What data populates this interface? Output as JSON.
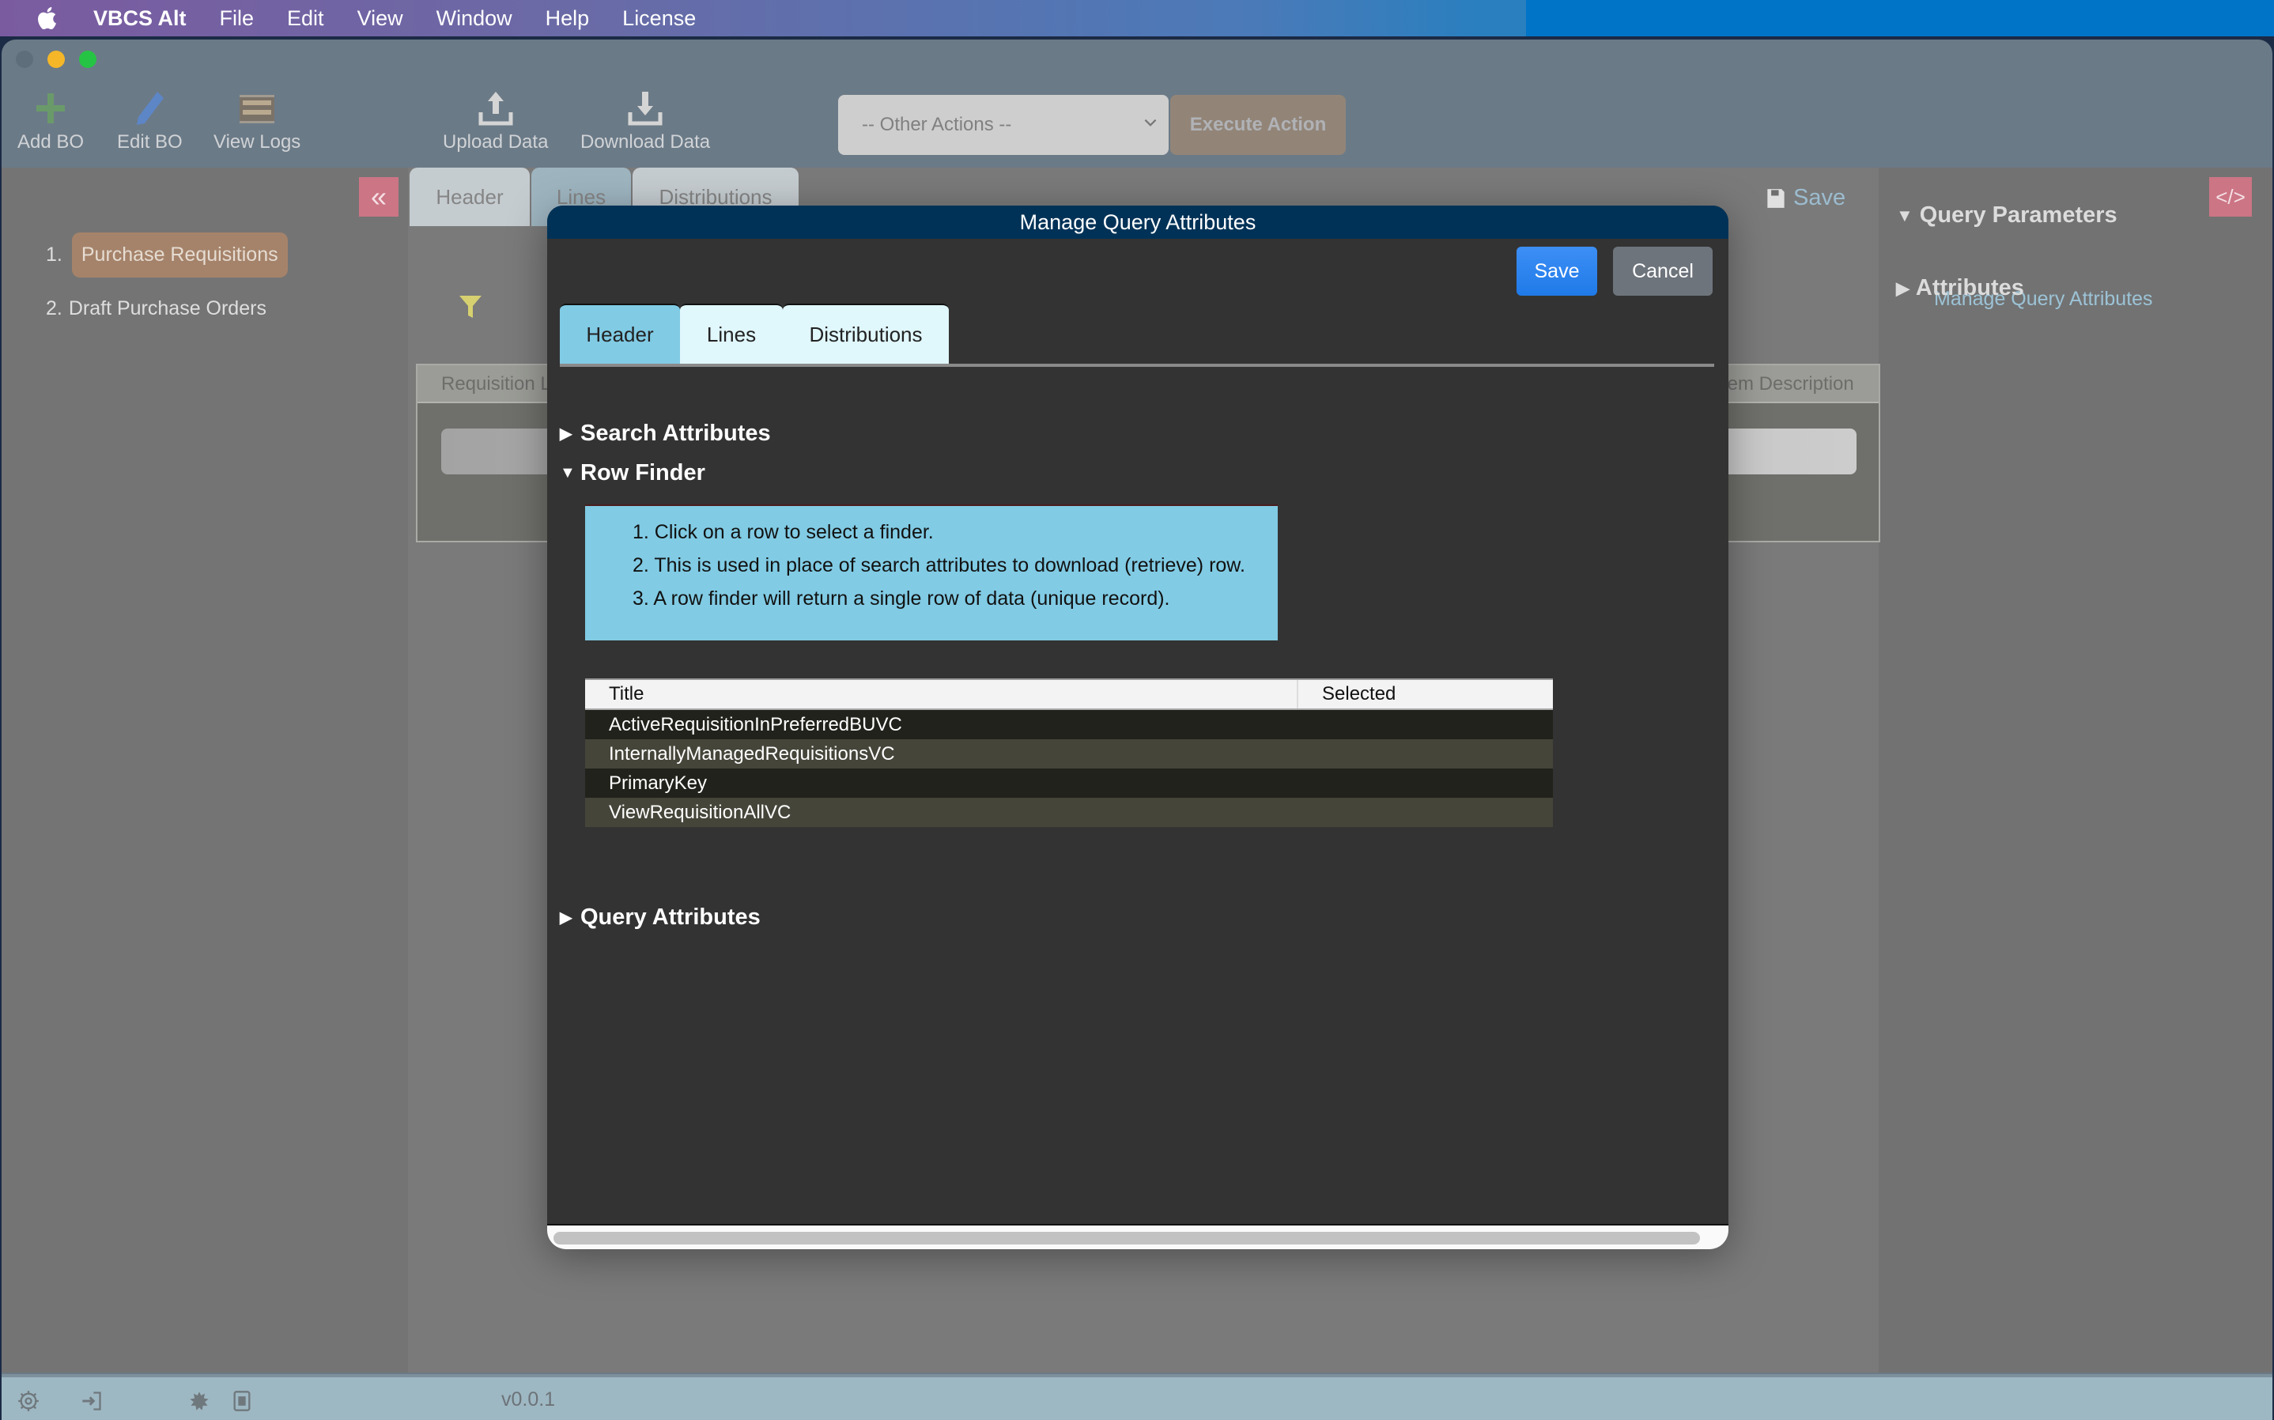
{
  "menubar": {
    "app_name": "VBCS Alt",
    "items": [
      "File",
      "Edit",
      "View",
      "Window",
      "Help",
      "License"
    ]
  },
  "toolbar": {
    "add_bo": "Add BO",
    "edit_bo": "Edit BO",
    "view_logs": "View Logs",
    "upload_data": "Upload Data",
    "download_data": "Download Data",
    "other_actions_selected": "-- Other Actions --",
    "execute_action": "Execute Action"
  },
  "sidebar": {
    "items": [
      {
        "num": "1.",
        "label": "Purchase Requisitions",
        "active": true
      },
      {
        "num": "2.",
        "label": "Draft Purchase Orders",
        "active": false
      }
    ]
  },
  "main": {
    "tabs": [
      "Header",
      "Lines",
      "Distributions"
    ],
    "active_tab": "Lines",
    "save_label": "Save",
    "table_headers": [
      "Requisition L",
      "tem Description"
    ]
  },
  "right_panel": {
    "query_parameters": "Query Parameters",
    "manage_query_attributes": "Manage Query Attributes",
    "attributes": "Attributes"
  },
  "statusbar": {
    "version": "v0.0.1"
  },
  "modal": {
    "title": "Manage Query Attributes",
    "save": "Save",
    "cancel": "Cancel",
    "tabs": [
      "Header",
      "Lines",
      "Distributions"
    ],
    "active_tab": "Header",
    "sections": {
      "search_attributes": "Search Attributes",
      "row_finder": "Row Finder",
      "query_attributes": "Query Attributes"
    },
    "instructions": [
      "1. Click on a row to select a finder.",
      "2. This is used in place of search attributes to download (retrieve) row.",
      "3. A row finder will return a single row of data (unique record)."
    ],
    "finder_table": {
      "columns": [
        "Title",
        "Selected"
      ],
      "rows": [
        {
          "title": "ActiveRequisitionInPreferredBUVC",
          "selected": ""
        },
        {
          "title": "InternallyManagedRequisitionsVC",
          "selected": ""
        },
        {
          "title": "PrimaryKey",
          "selected": ""
        },
        {
          "title": "ViewRequisitionAllVC",
          "selected": ""
        }
      ]
    }
  }
}
